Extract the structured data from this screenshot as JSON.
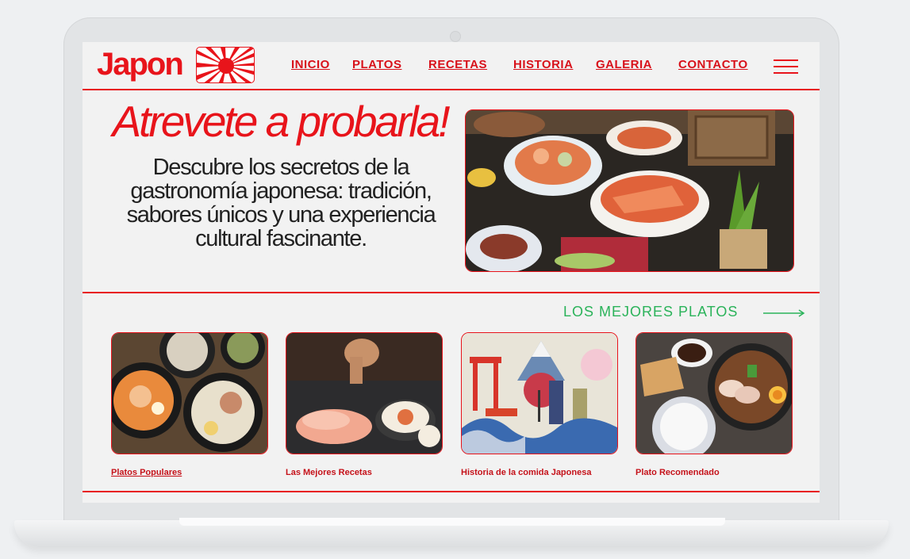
{
  "brand": {
    "logo_text": "Japon",
    "accent": "#e8141b",
    "link_color": "#d8111a"
  },
  "nav": {
    "items": [
      {
        "label": "INICIO"
      },
      {
        "label": "PLATOS"
      },
      {
        "label": "RECETAS"
      },
      {
        "label": "HISTORIA"
      },
      {
        "label": "GALERIA"
      },
      {
        "label": "CONTACTO"
      }
    ],
    "menu_icon": "hamburger-menu-icon"
  },
  "hero": {
    "title": "Atrevete a probarla!",
    "subtitle": "Descubre los secretos de la gastronomía japonesa: tradición, sabores únicos y una experiencia cultural fascinante."
  },
  "section": {
    "title": "LOS MEJORES PLATOS",
    "arrow_icon": "arrow-right-icon",
    "color": "#2bb35a"
  },
  "cards": [
    {
      "label": "Platos Populares",
      "image": "ramen-bowls"
    },
    {
      "label": "Las Mejores Recetas",
      "image": "sushi-rolls"
    },
    {
      "label": "Historia de la comida Japonesa",
      "image": "ukiyo-e-illustration"
    },
    {
      "label": "Plato Recomendado",
      "image": "ramen-and-rice"
    }
  ]
}
